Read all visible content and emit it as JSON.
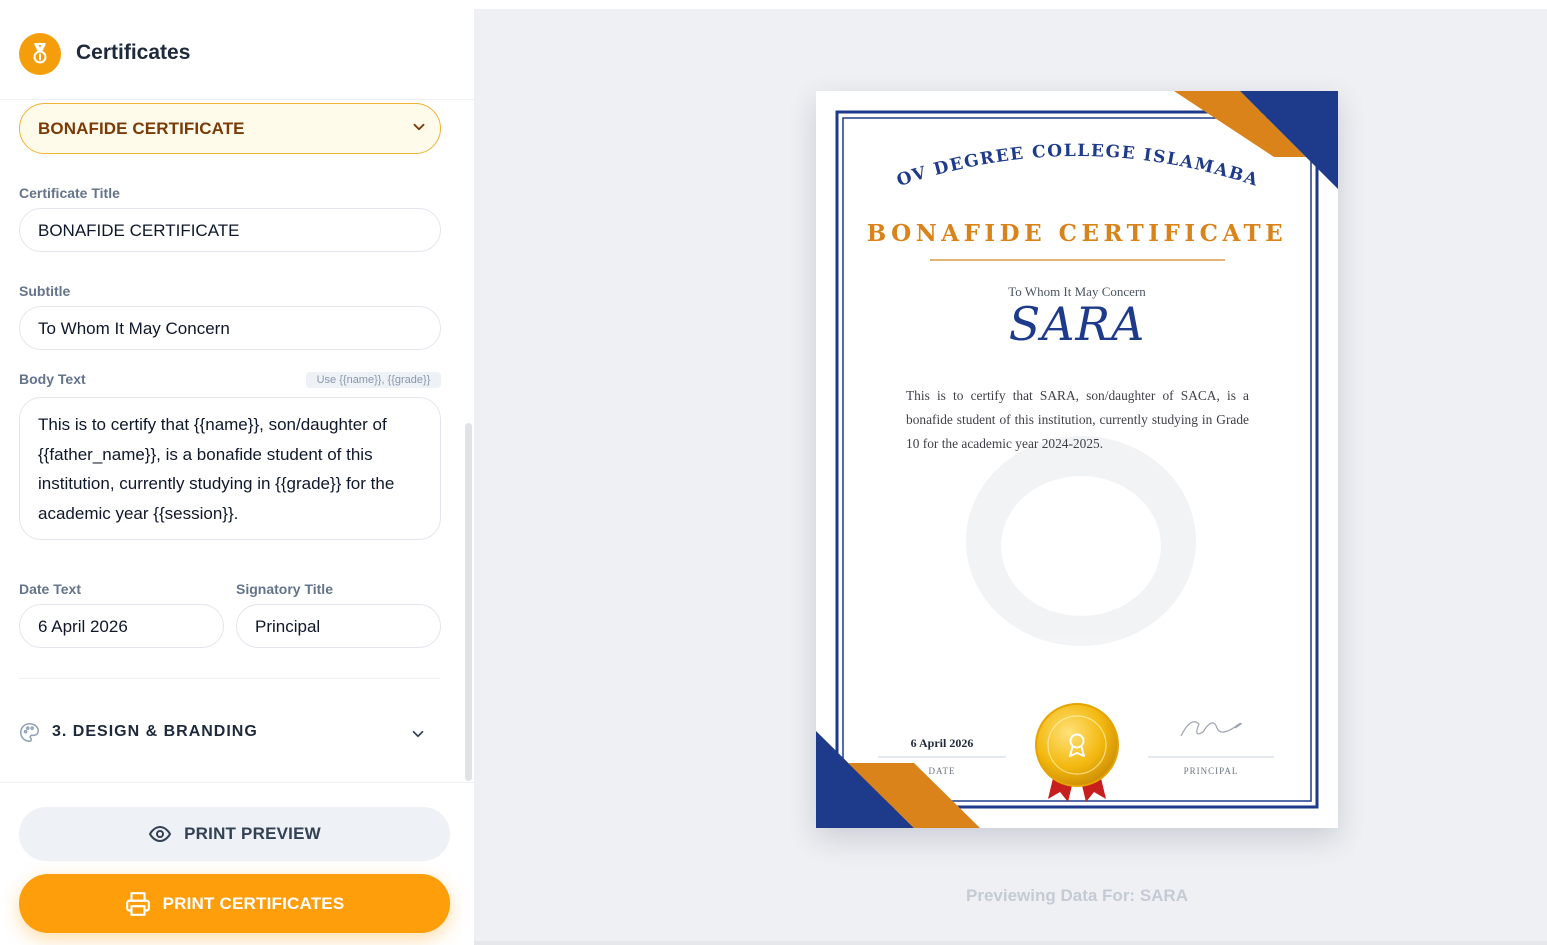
{
  "app": {
    "title": "Certificates",
    "icon": "medal-icon"
  },
  "template_select": {
    "selected": "BONAFIDE CERTIFICATE"
  },
  "form": {
    "title_label": "Certificate Title",
    "title_value": "BONAFIDE CERTIFICATE",
    "subtitle_label": "Subtitle",
    "subtitle_value": "To Whom It May Concern",
    "body_label": "Body Text",
    "body_hint": "Use {{name}}, {{grade}}",
    "body_value": "This is to certify that {{name}}, son/daughter of {{father_name}}, is a bonafide student of this institution, currently studying in {{grade}} for the academic year {{session}}.",
    "date_label": "Date Text",
    "date_value": "6 April 2026",
    "signatory_label": "Signatory Title",
    "signatory_value": "Principal"
  },
  "design_section": {
    "label": "3. DESIGN & BRANDING",
    "icon": "palette-icon"
  },
  "buttons": {
    "preview": "PRINT PREVIEW",
    "print": "PRINT CERTIFICATES"
  },
  "certificate": {
    "institution": "GOV DEGREE COLLEGE ISLAMABAD",
    "title": "BONAFIDE CERTIFICATE",
    "subtitle": "To Whom It May Concern",
    "student_name": "SARA",
    "body": "This is to certify that SARA, son/daughter of SACA, is a bonafide student of this institution, currently studying in Grade 10 for the academic year 2024-2025.",
    "date": "6 April 2026",
    "date_label": "DATE",
    "signatory_label": "PRINCIPAL"
  },
  "preview_caption": "Previewing Data For: SARA",
  "colors": {
    "accent": "#ff9e0b",
    "navy": "#1e3a8a",
    "gold": "#d9831a"
  }
}
